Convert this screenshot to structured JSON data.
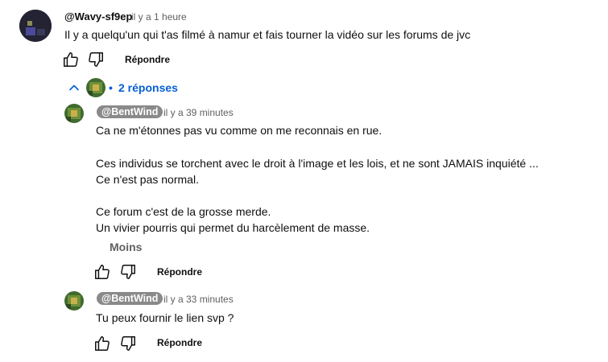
{
  "comment": {
    "author": "@Wavy-sf9ep",
    "time": "il y a 1 heure",
    "text": "Il y a quelqu'un qui t'as filmé à namur et fais tourner la vidéo sur les forums de jvc",
    "reply_label": "Répondre"
  },
  "replies_toggle": {
    "bullet": "•",
    "label": "2 réponses"
  },
  "replies": [
    {
      "author": "@BentWind",
      "time": "il y a 39 minutes",
      "lines": [
        "Ca ne m'étonnes pas vu comme on me reconnais en rue.",
        "Ces individus se torchent avec le droit à l'image et les lois, et ne sont JAMAIS inquiété ...",
        "Ce n'est pas normal.",
        "Ce forum c'est de la grosse merde.",
        "Un vivier pourris qui permet du harcèlement de masse."
      ],
      "less_label": "Moins",
      "reply_label": "Répondre"
    },
    {
      "author": "@BentWind",
      "time": "il y a 33 minutes",
      "lines": [
        "Tu peux fournir le lien svp ?"
      ],
      "reply_label": "Répondre"
    }
  ],
  "colors": {
    "link": "#065fd4",
    "pill": "#8a8a8a",
    "meta": "#606060"
  },
  "icons": {
    "like": "thumbs-up-icon",
    "dislike": "thumbs-down-icon",
    "collapse": "chevron-up-icon"
  }
}
